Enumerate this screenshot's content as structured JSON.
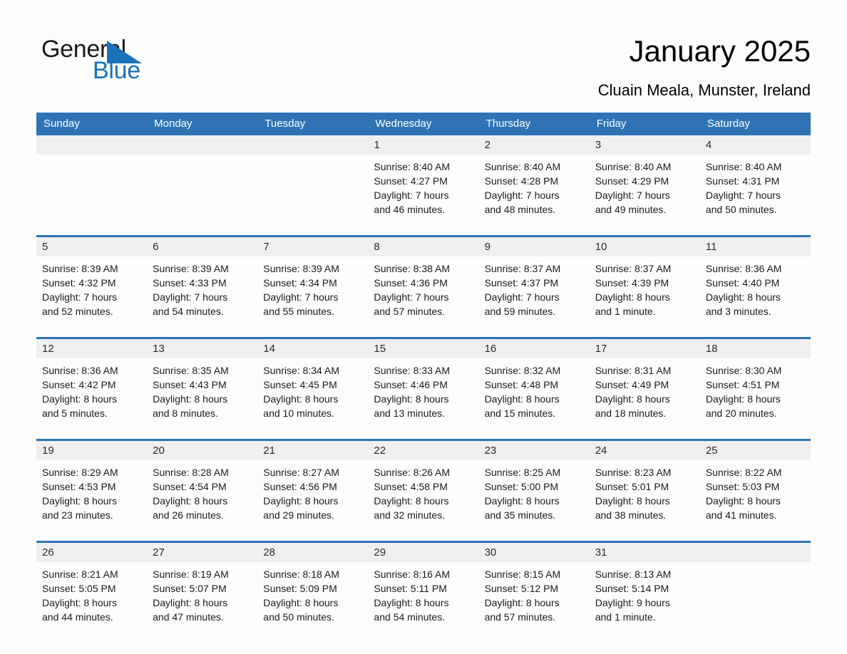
{
  "brand": {
    "word_one": "General",
    "word_two": "Blue",
    "accent_color": "#1b72b8",
    "triangle_icon": "brand-triangle-icon"
  },
  "header": {
    "title": "January 2025",
    "subtitle": "Cluain Meala, Munster, Ireland"
  },
  "theme": {
    "header_blue": "#2e74b5",
    "daynum_band": "#efefef",
    "page_background": "#fdfdfd"
  },
  "weekday_headers": [
    "Sunday",
    "Monday",
    "Tuesday",
    "Wednesday",
    "Thursday",
    "Friday",
    "Saturday"
  ],
  "weeks": [
    [
      {
        "day": "",
        "sunrise": "",
        "sunset": "",
        "daylight_line1": "",
        "daylight_line2": ""
      },
      {
        "day": "",
        "sunrise": "",
        "sunset": "",
        "daylight_line1": "",
        "daylight_line2": ""
      },
      {
        "day": "",
        "sunrise": "",
        "sunset": "",
        "daylight_line1": "",
        "daylight_line2": ""
      },
      {
        "day": "1",
        "sunrise": "Sunrise: 8:40 AM",
        "sunset": "Sunset: 4:27 PM",
        "daylight_line1": "Daylight: 7 hours",
        "daylight_line2": "and 46 minutes."
      },
      {
        "day": "2",
        "sunrise": "Sunrise: 8:40 AM",
        "sunset": "Sunset: 4:28 PM",
        "daylight_line1": "Daylight: 7 hours",
        "daylight_line2": "and 48 minutes."
      },
      {
        "day": "3",
        "sunrise": "Sunrise: 8:40 AM",
        "sunset": "Sunset: 4:29 PM",
        "daylight_line1": "Daylight: 7 hours",
        "daylight_line2": "and 49 minutes."
      },
      {
        "day": "4",
        "sunrise": "Sunrise: 8:40 AM",
        "sunset": "Sunset: 4:31 PM",
        "daylight_line1": "Daylight: 7 hours",
        "daylight_line2": "and 50 minutes."
      }
    ],
    [
      {
        "day": "5",
        "sunrise": "Sunrise: 8:39 AM",
        "sunset": "Sunset: 4:32 PM",
        "daylight_line1": "Daylight: 7 hours",
        "daylight_line2": "and 52 minutes."
      },
      {
        "day": "6",
        "sunrise": "Sunrise: 8:39 AM",
        "sunset": "Sunset: 4:33 PM",
        "daylight_line1": "Daylight: 7 hours",
        "daylight_line2": "and 54 minutes."
      },
      {
        "day": "7",
        "sunrise": "Sunrise: 8:39 AM",
        "sunset": "Sunset: 4:34 PM",
        "daylight_line1": "Daylight: 7 hours",
        "daylight_line2": "and 55 minutes."
      },
      {
        "day": "8",
        "sunrise": "Sunrise: 8:38 AM",
        "sunset": "Sunset: 4:36 PM",
        "daylight_line1": "Daylight: 7 hours",
        "daylight_line2": "and 57 minutes."
      },
      {
        "day": "9",
        "sunrise": "Sunrise: 8:37 AM",
        "sunset": "Sunset: 4:37 PM",
        "daylight_line1": "Daylight: 7 hours",
        "daylight_line2": "and 59 minutes."
      },
      {
        "day": "10",
        "sunrise": "Sunrise: 8:37 AM",
        "sunset": "Sunset: 4:39 PM",
        "daylight_line1": "Daylight: 8 hours",
        "daylight_line2": "and 1 minute."
      },
      {
        "day": "11",
        "sunrise": "Sunrise: 8:36 AM",
        "sunset": "Sunset: 4:40 PM",
        "daylight_line1": "Daylight: 8 hours",
        "daylight_line2": "and 3 minutes."
      }
    ],
    [
      {
        "day": "12",
        "sunrise": "Sunrise: 8:36 AM",
        "sunset": "Sunset: 4:42 PM",
        "daylight_line1": "Daylight: 8 hours",
        "daylight_line2": "and 5 minutes."
      },
      {
        "day": "13",
        "sunrise": "Sunrise: 8:35 AM",
        "sunset": "Sunset: 4:43 PM",
        "daylight_line1": "Daylight: 8 hours",
        "daylight_line2": "and 8 minutes."
      },
      {
        "day": "14",
        "sunrise": "Sunrise: 8:34 AM",
        "sunset": "Sunset: 4:45 PM",
        "daylight_line1": "Daylight: 8 hours",
        "daylight_line2": "and 10 minutes."
      },
      {
        "day": "15",
        "sunrise": "Sunrise: 8:33 AM",
        "sunset": "Sunset: 4:46 PM",
        "daylight_line1": "Daylight: 8 hours",
        "daylight_line2": "and 13 minutes."
      },
      {
        "day": "16",
        "sunrise": "Sunrise: 8:32 AM",
        "sunset": "Sunset: 4:48 PM",
        "daylight_line1": "Daylight: 8 hours",
        "daylight_line2": "and 15 minutes."
      },
      {
        "day": "17",
        "sunrise": "Sunrise: 8:31 AM",
        "sunset": "Sunset: 4:49 PM",
        "daylight_line1": "Daylight: 8 hours",
        "daylight_line2": "and 18 minutes."
      },
      {
        "day": "18",
        "sunrise": "Sunrise: 8:30 AM",
        "sunset": "Sunset: 4:51 PM",
        "daylight_line1": "Daylight: 8 hours",
        "daylight_line2": "and 20 minutes."
      }
    ],
    [
      {
        "day": "19",
        "sunrise": "Sunrise: 8:29 AM",
        "sunset": "Sunset: 4:53 PM",
        "daylight_line1": "Daylight: 8 hours",
        "daylight_line2": "and 23 minutes."
      },
      {
        "day": "20",
        "sunrise": "Sunrise: 8:28 AM",
        "sunset": "Sunset: 4:54 PM",
        "daylight_line1": "Daylight: 8 hours",
        "daylight_line2": "and 26 minutes."
      },
      {
        "day": "21",
        "sunrise": "Sunrise: 8:27 AM",
        "sunset": "Sunset: 4:56 PM",
        "daylight_line1": "Daylight: 8 hours",
        "daylight_line2": "and 29 minutes."
      },
      {
        "day": "22",
        "sunrise": "Sunrise: 8:26 AM",
        "sunset": "Sunset: 4:58 PM",
        "daylight_line1": "Daylight: 8 hours",
        "daylight_line2": "and 32 minutes."
      },
      {
        "day": "23",
        "sunrise": "Sunrise: 8:25 AM",
        "sunset": "Sunset: 5:00 PM",
        "daylight_line1": "Daylight: 8 hours",
        "daylight_line2": "and 35 minutes."
      },
      {
        "day": "24",
        "sunrise": "Sunrise: 8:23 AM",
        "sunset": "Sunset: 5:01 PM",
        "daylight_line1": "Daylight: 8 hours",
        "daylight_line2": "and 38 minutes."
      },
      {
        "day": "25",
        "sunrise": "Sunrise: 8:22 AM",
        "sunset": "Sunset: 5:03 PM",
        "daylight_line1": "Daylight: 8 hours",
        "daylight_line2": "and 41 minutes."
      }
    ],
    [
      {
        "day": "26",
        "sunrise": "Sunrise: 8:21 AM",
        "sunset": "Sunset: 5:05 PM",
        "daylight_line1": "Daylight: 8 hours",
        "daylight_line2": "and 44 minutes."
      },
      {
        "day": "27",
        "sunrise": "Sunrise: 8:19 AM",
        "sunset": "Sunset: 5:07 PM",
        "daylight_line1": "Daylight: 8 hours",
        "daylight_line2": "and 47 minutes."
      },
      {
        "day": "28",
        "sunrise": "Sunrise: 8:18 AM",
        "sunset": "Sunset: 5:09 PM",
        "daylight_line1": "Daylight: 8 hours",
        "daylight_line2": "and 50 minutes."
      },
      {
        "day": "29",
        "sunrise": "Sunrise: 8:16 AM",
        "sunset": "Sunset: 5:11 PM",
        "daylight_line1": "Daylight: 8 hours",
        "daylight_line2": "and 54 minutes."
      },
      {
        "day": "30",
        "sunrise": "Sunrise: 8:15 AM",
        "sunset": "Sunset: 5:12 PM",
        "daylight_line1": "Daylight: 8 hours",
        "daylight_line2": "and 57 minutes."
      },
      {
        "day": "31",
        "sunrise": "Sunrise: 8:13 AM",
        "sunset": "Sunset: 5:14 PM",
        "daylight_line1": "Daylight: 9 hours",
        "daylight_line2": "and 1 minute."
      },
      {
        "day": "",
        "sunrise": "",
        "sunset": "",
        "daylight_line1": "",
        "daylight_line2": ""
      }
    ]
  ]
}
